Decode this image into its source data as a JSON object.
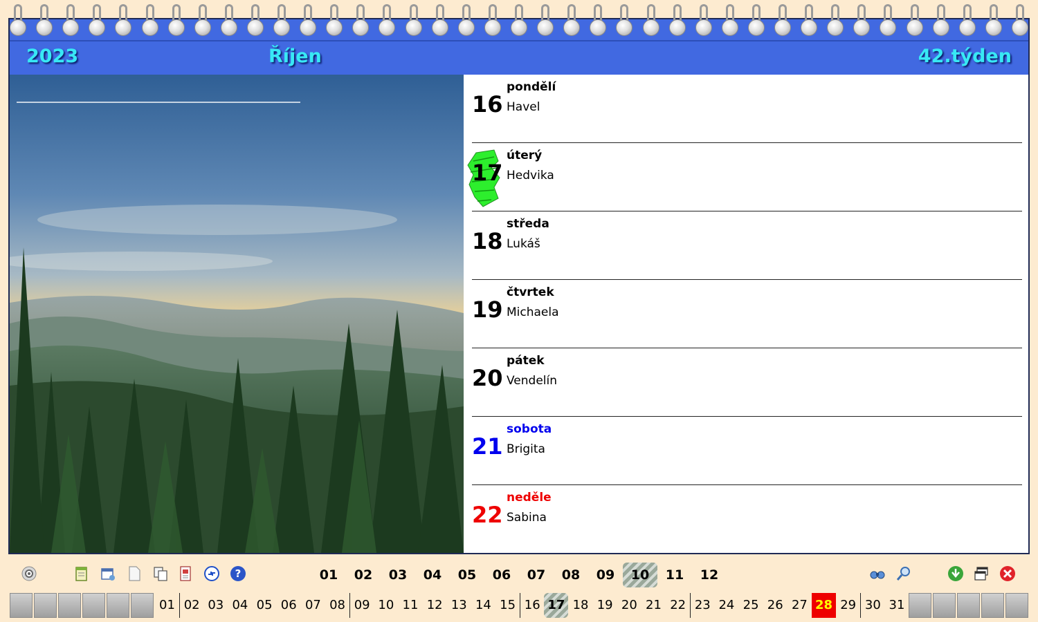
{
  "header": {
    "year": "2023",
    "month": "Říjen",
    "week": "42.týden"
  },
  "days": [
    {
      "num": "16",
      "name": "pondělí",
      "nameday": "Havel",
      "kind": "weekday",
      "today": false
    },
    {
      "num": "17",
      "name": "úterý",
      "nameday": "Hedvika",
      "kind": "weekday",
      "today": true
    },
    {
      "num": "18",
      "name": "středa",
      "nameday": "Lukáš",
      "kind": "weekday",
      "today": false
    },
    {
      "num": "19",
      "name": "čtvrtek",
      "nameday": "Michaela",
      "kind": "weekday",
      "today": false
    },
    {
      "num": "20",
      "name": "pátek",
      "nameday": "Vendelín",
      "kind": "weekday",
      "today": false
    },
    {
      "num": "21",
      "name": "sobota",
      "nameday": "Brigita",
      "kind": "saturday",
      "today": false
    },
    {
      "num": "22",
      "name": "neděle",
      "nameday": "Sabina",
      "kind": "sunday",
      "today": false
    }
  ],
  "toolbar": {
    "left_icons": [
      "settings-icon",
      "notes-icon",
      "calendar-edit-icon",
      "blank-page-icon",
      "copy-icon",
      "print-icon",
      "sync-icon",
      "help-icon"
    ],
    "right_icons": [
      "binoculars-icon",
      "zoom-icon",
      "download-icon",
      "windows-icon",
      "close-icon"
    ]
  },
  "months": [
    "01",
    "02",
    "03",
    "04",
    "05",
    "06",
    "07",
    "08",
    "09",
    "10",
    "11",
    "12"
  ],
  "active_month": "10",
  "day_strip": [
    "01",
    "02",
    "03",
    "04",
    "05",
    "06",
    "07",
    "08",
    "09",
    "10",
    "11",
    "12",
    "13",
    "14",
    "15",
    "16",
    "17",
    "18",
    "19",
    "20",
    "21",
    "22",
    "23",
    "24",
    "25",
    "26",
    "27",
    "28",
    "29",
    "30",
    "31"
  ],
  "current_day": "17",
  "highlight_day": "28",
  "colors": {
    "header_bg": "#4169e1",
    "header_text": "#38e8f5",
    "saturday": "#0000ee",
    "sunday": "#ee0000",
    "page_bg": "#fdebd0"
  }
}
